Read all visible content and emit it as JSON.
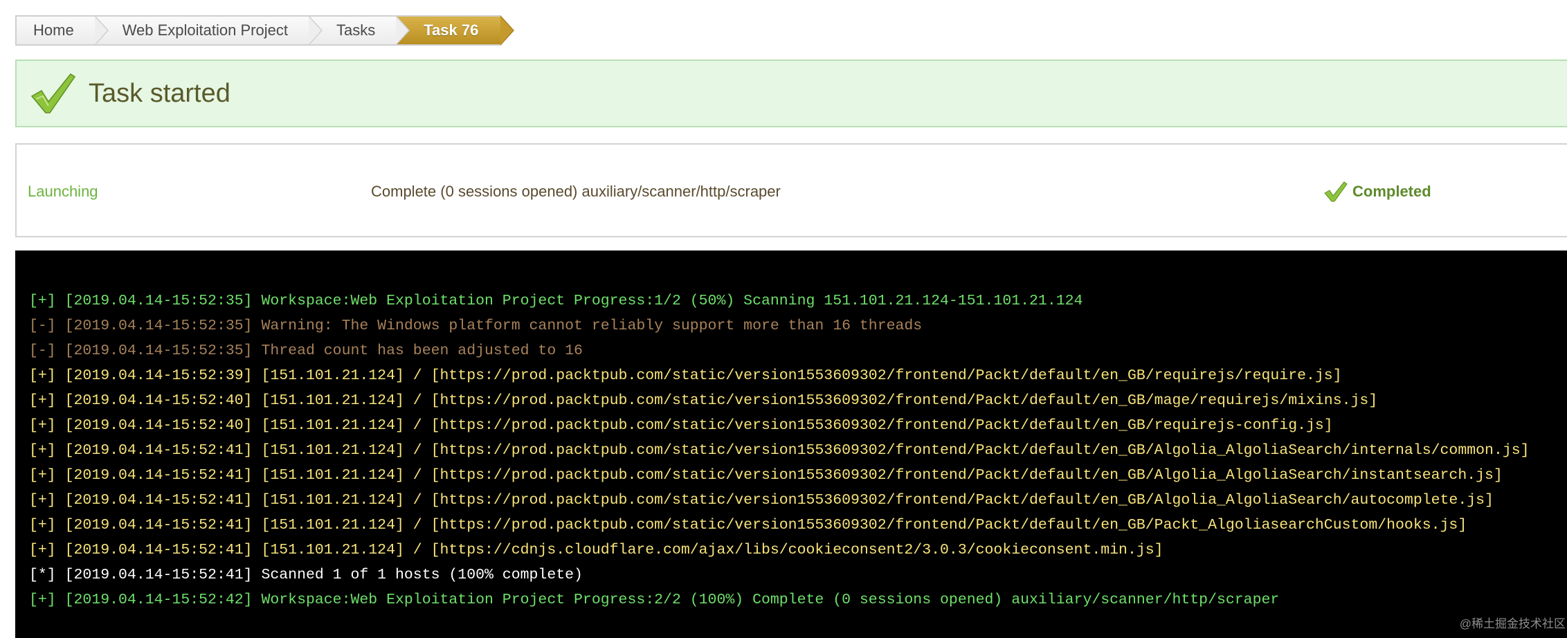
{
  "breadcrumb": {
    "items": [
      "Home",
      "Web Exploitation Project",
      "Tasks",
      "Task 76"
    ]
  },
  "banner": {
    "icon": "checkmark-icon",
    "title": "Task started"
  },
  "status": {
    "phase": "Launching",
    "message": "Complete (0 sessions opened) auxiliary/scanner/http/scraper",
    "state_icon": "checkmark-icon",
    "state": "Completed"
  },
  "console": {
    "colors": {
      "info": "#6ee06a",
      "warn": "#a8825a",
      "found": "#f7e37a",
      "note": "#ffffff"
    },
    "lines": [
      {
        "type": "info",
        "text": "[+] [2019.04.14-15:52:35] Workspace:Web Exploitation Project Progress:1/2 (50%) Scanning 151.101.21.124-151.101.21.124"
      },
      {
        "type": "warn",
        "text": "[-] [2019.04.14-15:52:35] Warning: The Windows platform cannot reliably support more than 16 threads"
      },
      {
        "type": "warn",
        "text": "[-] [2019.04.14-15:52:35] Thread count has been adjusted to 16"
      },
      {
        "type": "found",
        "text": "[+] [2019.04.14-15:52:39] [151.101.21.124] / [https://prod.packtpub.com/static/version1553609302/frontend/Packt/default/en_GB/requirejs/require.js]"
      },
      {
        "type": "found",
        "text": "[+] [2019.04.14-15:52:40] [151.101.21.124] / [https://prod.packtpub.com/static/version1553609302/frontend/Packt/default/en_GB/mage/requirejs/mixins.js]"
      },
      {
        "type": "found",
        "text": "[+] [2019.04.14-15:52:40] [151.101.21.124] / [https://prod.packtpub.com/static/version1553609302/frontend/Packt/default/en_GB/requirejs-config.js]"
      },
      {
        "type": "found",
        "text": "[+] [2019.04.14-15:52:41] [151.101.21.124] / [https://prod.packtpub.com/static/version1553609302/frontend/Packt/default/en_GB/Algolia_AlgoliaSearch/internals/common.js]"
      },
      {
        "type": "found",
        "text": "[+] [2019.04.14-15:52:41] [151.101.21.124] / [https://prod.packtpub.com/static/version1553609302/frontend/Packt/default/en_GB/Algolia_AlgoliaSearch/instantsearch.js]"
      },
      {
        "type": "found",
        "text": "[+] [2019.04.14-15:52:41] [151.101.21.124] / [https://prod.packtpub.com/static/version1553609302/frontend/Packt/default/en_GB/Algolia_AlgoliaSearch/autocomplete.js]"
      },
      {
        "type": "found",
        "text": "[+] [2019.04.14-15:52:41] [151.101.21.124] / [https://prod.packtpub.com/static/version1553609302/frontend/Packt/default/en_GB/Packt_AlgoliasearchCustom/hooks.js]"
      },
      {
        "type": "found",
        "text": "[+] [2019.04.14-15:52:41] [151.101.21.124] / [https://cdnjs.cloudflare.com/ajax/libs/cookieconsent2/3.0.3/cookieconsent.min.js]"
      },
      {
        "type": "note",
        "text": "[*] [2019.04.14-15:52:41] Scanned 1 of 1 hosts (100% complete)"
      },
      {
        "type": "info",
        "text": "[+] [2019.04.14-15:52:42] Workspace:Web Exploitation Project Progress:2/2 (100%) Complete (0 sessions opened) auxiliary/scanner/http/scraper"
      }
    ]
  },
  "watermark": "@稀土掘金技术社区"
}
